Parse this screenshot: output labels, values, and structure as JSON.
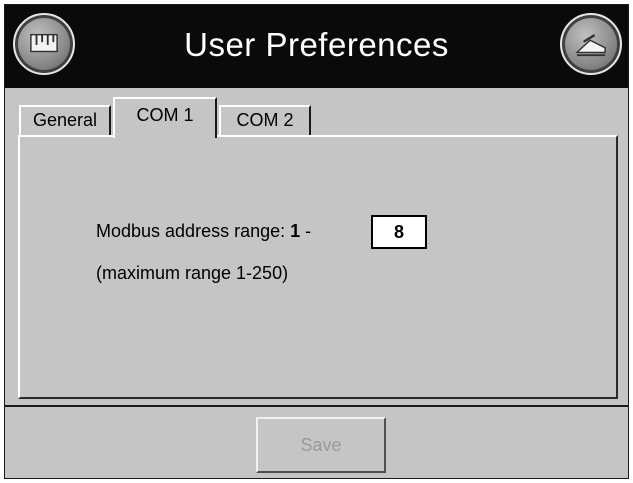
{
  "header": {
    "title": "User Preferences",
    "left_icon": "ruler-icon",
    "right_icon": "exit-icon"
  },
  "tabs": [
    {
      "label": "General",
      "active": false
    },
    {
      "label": "COM 1",
      "active": true
    },
    {
      "label": "COM 2",
      "active": false
    }
  ],
  "com1": {
    "modbus_label": "Modbus address range:",
    "range_start": "1",
    "range_separator": "-",
    "range_end_value": "8",
    "range_note": "(maximum range 1-250)"
  },
  "footer": {
    "save_label": "Save",
    "save_enabled": false
  },
  "colors": {
    "background": "#c5c5c5",
    "titlebar": "#0a0a0a",
    "title_text": "#ffffff",
    "disabled_text": "#9a9a9a"
  }
}
